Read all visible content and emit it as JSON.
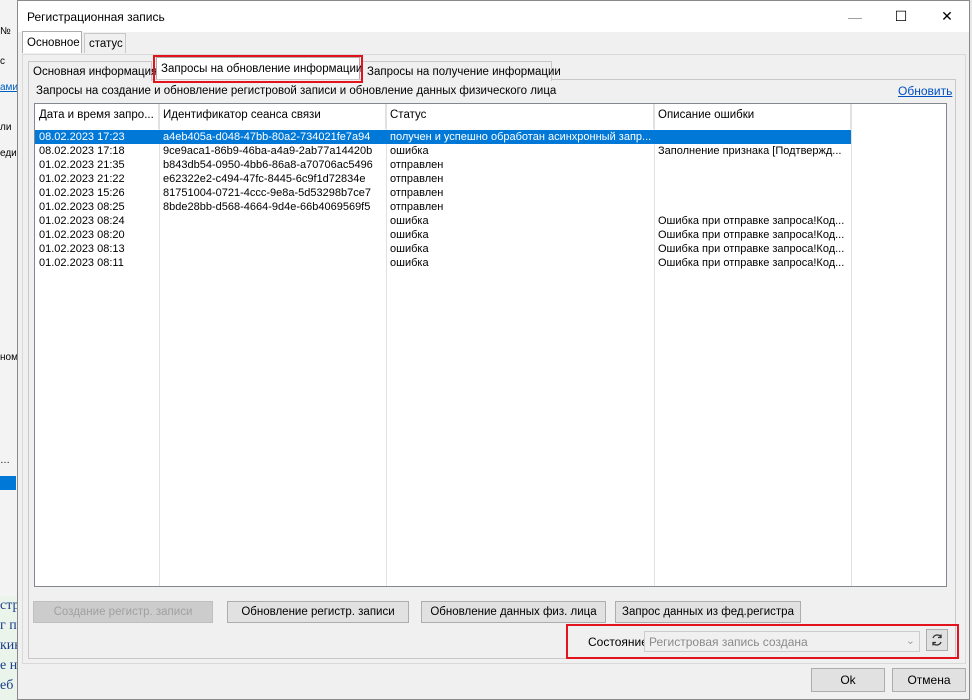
{
  "window": {
    "title": "Регистрационная запись",
    "minimize_glyph": "—",
    "maximize_glyph": "☐",
    "close_glyph": "✕"
  },
  "background_fragments": [
    "№",
    "с",
    "ами",
    "ли",
    "еди",
    "ном",
    "…",
    "стр",
    "г п",
    "кин",
    "е н",
    "еб"
  ],
  "top_tabs": [
    {
      "label": "Основное",
      "active": true
    },
    {
      "label": "статус",
      "active": false
    }
  ],
  "inner_tabs": [
    {
      "label": "Основная информация",
      "active": false
    },
    {
      "label": "Запросы на обновление информации",
      "active": true
    },
    {
      "label": "Запросы на получение информации",
      "active": false
    }
  ],
  "panel": {
    "caption": "Запросы на создание и обновление регистровой записи и обновление данных физического лица",
    "refresh_link": "Обновить"
  },
  "grid": {
    "columns": [
      "Дата и время запро...",
      "Идентификатор сеанса связи",
      "Статус",
      "Описание ошибки"
    ],
    "rows": [
      {
        "date": "08.02.2023 17:23",
        "session": "a4eb405a-d048-47bb-80a2-734021fe7a94",
        "status": "получен и успешно обработан асинхронный запр...",
        "error": "",
        "selected": true
      },
      {
        "date": "08.02.2023 17:18",
        "session": "9ce9aca1-86b9-46ba-a4a9-2ab77a14420b",
        "status": "ошибка",
        "error": "Заполнение признака [Подтвержд...",
        "selected": false
      },
      {
        "date": "01.02.2023 21:35",
        "session": "b843db54-0950-4bb6-86a8-a70706ac5496",
        "status": "отправлен",
        "error": "",
        "selected": false
      },
      {
        "date": "01.02.2023 21:22",
        "session": "e62322e2-c494-47fc-8445-6c9f1d72834e",
        "status": "отправлен",
        "error": "",
        "selected": false
      },
      {
        "date": "01.02.2023 15:26",
        "session": "81751004-0721-4ccc-9e8a-5d53298b7ce7",
        "status": "отправлен",
        "error": "",
        "selected": false
      },
      {
        "date": "01.02.2023 08:25",
        "session": "8bde28bb-d568-4664-9d4e-66b4069569f5",
        "status": "отправлен",
        "error": "",
        "selected": false
      },
      {
        "date": "01.02.2023 08:24",
        "session": "",
        "status": "ошибка",
        "error": "Ошибка при отправке запроса!Код...",
        "selected": false
      },
      {
        "date": "01.02.2023 08:20",
        "session": "",
        "status": "ошибка",
        "error": "Ошибка при отправке запроса!Код...",
        "selected": false
      },
      {
        "date": "01.02.2023 08:13",
        "session": "",
        "status": "ошибка",
        "error": "Ошибка при отправке запроса!Код...",
        "selected": false
      },
      {
        "date": "01.02.2023 08:11",
        "session": "",
        "status": "ошибка",
        "error": "Ошибка при отправке запроса!Код...",
        "selected": false
      }
    ]
  },
  "actions": {
    "create": {
      "label": "Создание регистр. записи",
      "disabled": true
    },
    "update": {
      "label": "Обновление регистр. записи",
      "disabled": false
    },
    "update_person": {
      "label": "Обновление данных физ. лица",
      "disabled": false
    },
    "fed_request": {
      "label": "Запрос данных из фед.регистра",
      "disabled": false
    }
  },
  "state": {
    "label": "Состояние:",
    "value": "Регистровая запись создана",
    "refresh_icon": "refresh-icon"
  },
  "footer": {
    "ok": "Ok",
    "cancel": "Отмена"
  },
  "colors": {
    "selection": "#0078d7",
    "highlight": "#e3131d",
    "link": "#0050c0"
  }
}
